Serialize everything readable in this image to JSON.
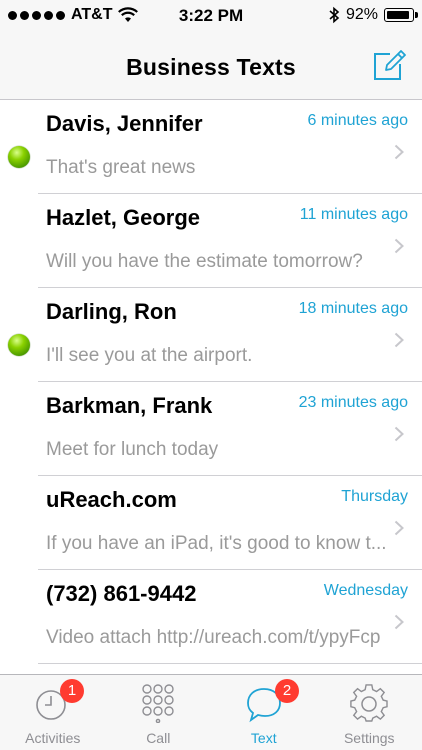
{
  "status_bar": {
    "carrier": "AT&T",
    "time": "3:22 PM",
    "battery_percent": "92%",
    "battery_level": 0.92
  },
  "nav": {
    "title": "Business Texts",
    "compose_icon": "compose-icon"
  },
  "messages": [
    {
      "name": "Davis, Jennifer",
      "time": "6 minutes ago",
      "preview": "That's great news",
      "online": true
    },
    {
      "name": "Hazlet, George",
      "time": "11 minutes ago",
      "preview": "Will you have the estimate tomorrow?",
      "online": false
    },
    {
      "name": "Darling, Ron",
      "time": "18 minutes ago",
      "preview": "I'll see you at the airport.",
      "online": true
    },
    {
      "name": "Barkman, Frank",
      "time": "23 minutes ago",
      "preview": "Meet for lunch today",
      "online": false
    },
    {
      "name": "uReach.com",
      "time": "Thursday",
      "preview": "If you have an iPad, it's good to know t...",
      "online": false
    },
    {
      "name": "(732) 861-9442",
      "time": "Wednesday",
      "preview": "Video attach http://ureach.com/t/ypyFcp",
      "online": false
    }
  ],
  "tabs": [
    {
      "label": "Activities",
      "icon": "clock-icon",
      "badge": "1",
      "active": false
    },
    {
      "label": "Call",
      "icon": "keypad-icon",
      "badge": "",
      "active": false
    },
    {
      "label": "Text",
      "icon": "chat-bubble-icon",
      "badge": "2",
      "active": true
    },
    {
      "label": "Settings",
      "icon": "gear-icon",
      "badge": "",
      "active": false
    }
  ],
  "colors": {
    "accent": "#1fa3d4",
    "online_dot": "#6cc000",
    "badge": "#ff3b30",
    "preview_text": "#9a9a9a"
  }
}
